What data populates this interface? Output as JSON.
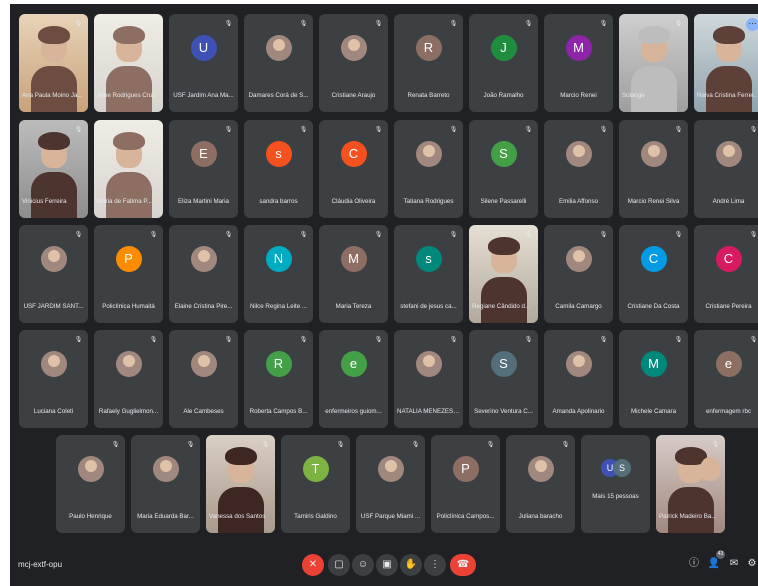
{
  "meeting": {
    "code": "mcj-extf-opu"
  },
  "rows": [
    [
      {
        "name": "Ana Paula Moino Ja...",
        "type": "video",
        "scene": "warm"
      },
      {
        "name": "Aline Rodrigues Cruz",
        "type": "video",
        "scene": "light"
      },
      {
        "name": "USF Jardim Ana Ma...",
        "type": "avatar",
        "initial": "U",
        "color": "#3f51b5"
      },
      {
        "name": "Damares Corá de S...",
        "type": "photo"
      },
      {
        "name": "Cristiane Araujo",
        "type": "photo"
      },
      {
        "name": "Renata Barreto",
        "type": "avatar",
        "initial": "R",
        "color": "#8d6e63"
      },
      {
        "name": "João Ramalho",
        "type": "avatar",
        "initial": "J",
        "color": "#1e8e3e"
      },
      {
        "name": "Marcio Renei",
        "type": "avatar",
        "initial": "M",
        "color": "#8e24aa"
      },
      {
        "name": "Solange",
        "type": "video",
        "scene": "grey"
      },
      {
        "name": "Nalva Cristina Ferreira...",
        "type": "video",
        "scene": "blue",
        "highlight": true
      }
    ],
    [
      {
        "name": "Vinicius Ferreira",
        "type": "video",
        "scene": "shelf"
      },
      {
        "name": "Maria de Fatima P...",
        "type": "video",
        "scene": "light"
      },
      {
        "name": "Eliza Martini Maria",
        "type": "avatar",
        "initial": "E",
        "color": "#8d6e63"
      },
      {
        "name": "sandra barros",
        "type": "avatar",
        "initial": "s",
        "color": "#f4511e"
      },
      {
        "name": "Cláudia Oliveira",
        "type": "avatar",
        "initial": "C",
        "color": "#f4511e"
      },
      {
        "name": "Tatiana Rodrigues",
        "type": "photo"
      },
      {
        "name": "Silene Passarelli",
        "type": "avatar",
        "initial": "S",
        "color": "#43a047"
      },
      {
        "name": "Emilia Affonso",
        "type": "photo"
      },
      {
        "name": "Marcio Renei Silva",
        "type": "photo"
      },
      {
        "name": "André Lima",
        "type": "photo"
      }
    ],
    [
      {
        "name": "USF JARDIM SANT...",
        "type": "photo"
      },
      {
        "name": "Policlínica Humaitá",
        "type": "avatar",
        "initial": "P",
        "color": "#fb8c00"
      },
      {
        "name": "Elaine Cristina Pire...",
        "type": "photo"
      },
      {
        "name": "Nilce Regina Leite ...",
        "type": "avatar",
        "initial": "N",
        "color": "#00acc1"
      },
      {
        "name": "Maria Tereza",
        "type": "avatar",
        "initial": "M",
        "color": "#8d6e63"
      },
      {
        "name": "stefani de jesus ca...",
        "type": "avatar",
        "initial": "s",
        "color": "#00897b"
      },
      {
        "name": "Regiane Cândido d...",
        "type": "video",
        "scene": "glasses"
      },
      {
        "name": "Camila Camargo",
        "type": "photo"
      },
      {
        "name": "Cristiane Da Costa",
        "type": "avatar",
        "initial": "C",
        "color": "#039be5"
      },
      {
        "name": "Cristiane Pereira",
        "type": "avatar",
        "initial": "C",
        "color": "#d81b60"
      }
    ],
    [
      {
        "name": "Luciana Coleti",
        "type": "photo"
      },
      {
        "name": "Rafaely Guglielmon...",
        "type": "photo"
      },
      {
        "name": "Ale Cambeses",
        "type": "photo"
      },
      {
        "name": "Roberta Campos B...",
        "type": "avatar",
        "initial": "R",
        "color": "#43a047"
      },
      {
        "name": "enfermeiros guiom...",
        "type": "avatar",
        "initial": "e",
        "color": "#43a047"
      },
      {
        "name": "NATALIA MENEZES ...",
        "type": "photo"
      },
      {
        "name": "Severino Ventura C...",
        "type": "avatar",
        "initial": "S",
        "color": "#546e7a"
      },
      {
        "name": "Amanda Apolinario",
        "type": "photo"
      },
      {
        "name": "Michele Camara",
        "type": "avatar",
        "initial": "M",
        "color": "#00897b"
      },
      {
        "name": "enfermagem rbc",
        "type": "avatar",
        "initial": "e",
        "color": "#8d6e63"
      }
    ],
    [
      {
        "name": "Paulo Henrique",
        "type": "photo"
      },
      {
        "name": "Maria Eduarda Bar...",
        "type": "photo"
      },
      {
        "name": "Vanessa dos Santos",
        "type": "video",
        "scene": "woman"
      },
      {
        "name": "Tamiris Galdino",
        "type": "avatar",
        "initial": "T",
        "color": "#7cb342"
      },
      {
        "name": "USF Parque Miami ...",
        "type": "photo"
      },
      {
        "name": "Policlínica Campos...",
        "type": "avatar",
        "initial": "P",
        "color": "#8d6e63"
      },
      {
        "name": "Juliana baracho",
        "type": "photo"
      },
      {
        "name": "Mais 15 pessoas",
        "type": "more"
      },
      {
        "name": "Patrick Madeiro Ba...",
        "type": "video",
        "scene": "two"
      }
    ]
  ],
  "controls": {
    "bottom_icons": [
      "mic-off-icon",
      "captions-icon",
      "emoji-icon",
      "present-icon",
      "raise-hand-icon",
      "more-options-icon",
      "end-call-icon"
    ],
    "right_icons": [
      "info-icon",
      "people-icon",
      "chat-icon",
      "activities-icon"
    ],
    "people_count": "43"
  }
}
